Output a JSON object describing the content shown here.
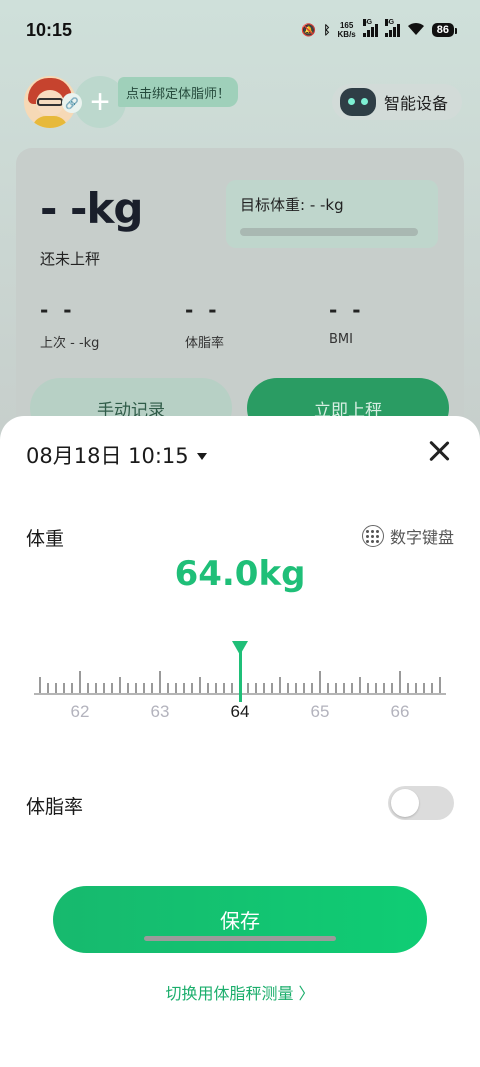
{
  "status_bar": {
    "time": "10:15",
    "net_speed_value": "165",
    "net_speed_unit": "KB/s",
    "sim1_tag": "5G",
    "sim2_tag": "5G",
    "battery": "86"
  },
  "header": {
    "coach_tip": "点击绑定体脂师！",
    "smart_device_label": "智能设备"
  },
  "summary": {
    "weight_display": "- -kg",
    "weight_status": "还未上秤",
    "target_label": "目标体重: - -kg",
    "stats": [
      {
        "value": "- -",
        "label": "上次 - -kg"
      },
      {
        "value": "- -",
        "label": "体脂率"
      },
      {
        "value": "- -",
        "label": "BMI"
      }
    ],
    "manual_record_label": "手动记录",
    "weigh_now_label": "立即上秤"
  },
  "sheet": {
    "datetime": "08月18日 10:15",
    "weight_section_label": "体重",
    "keypad_label": "数字键盘",
    "weight_value": "64.0kg",
    "ruler": {
      "current": 64.0,
      "labels": [
        "62",
        "63",
        "64",
        "65",
        "66"
      ]
    },
    "body_fat_label": "体脂率",
    "body_fat_enabled": false,
    "save_label": "保存",
    "switch_link_label": "切换用体脂秤测量 〉"
  },
  "colors": {
    "accent": "#1fbf78",
    "save_button": "#12c470",
    "link": "#1cae6c"
  },
  "icons": [
    "caret-down-icon",
    "close-icon",
    "keypad-icon",
    "robot-icon",
    "add-icon",
    "link-icon"
  ]
}
